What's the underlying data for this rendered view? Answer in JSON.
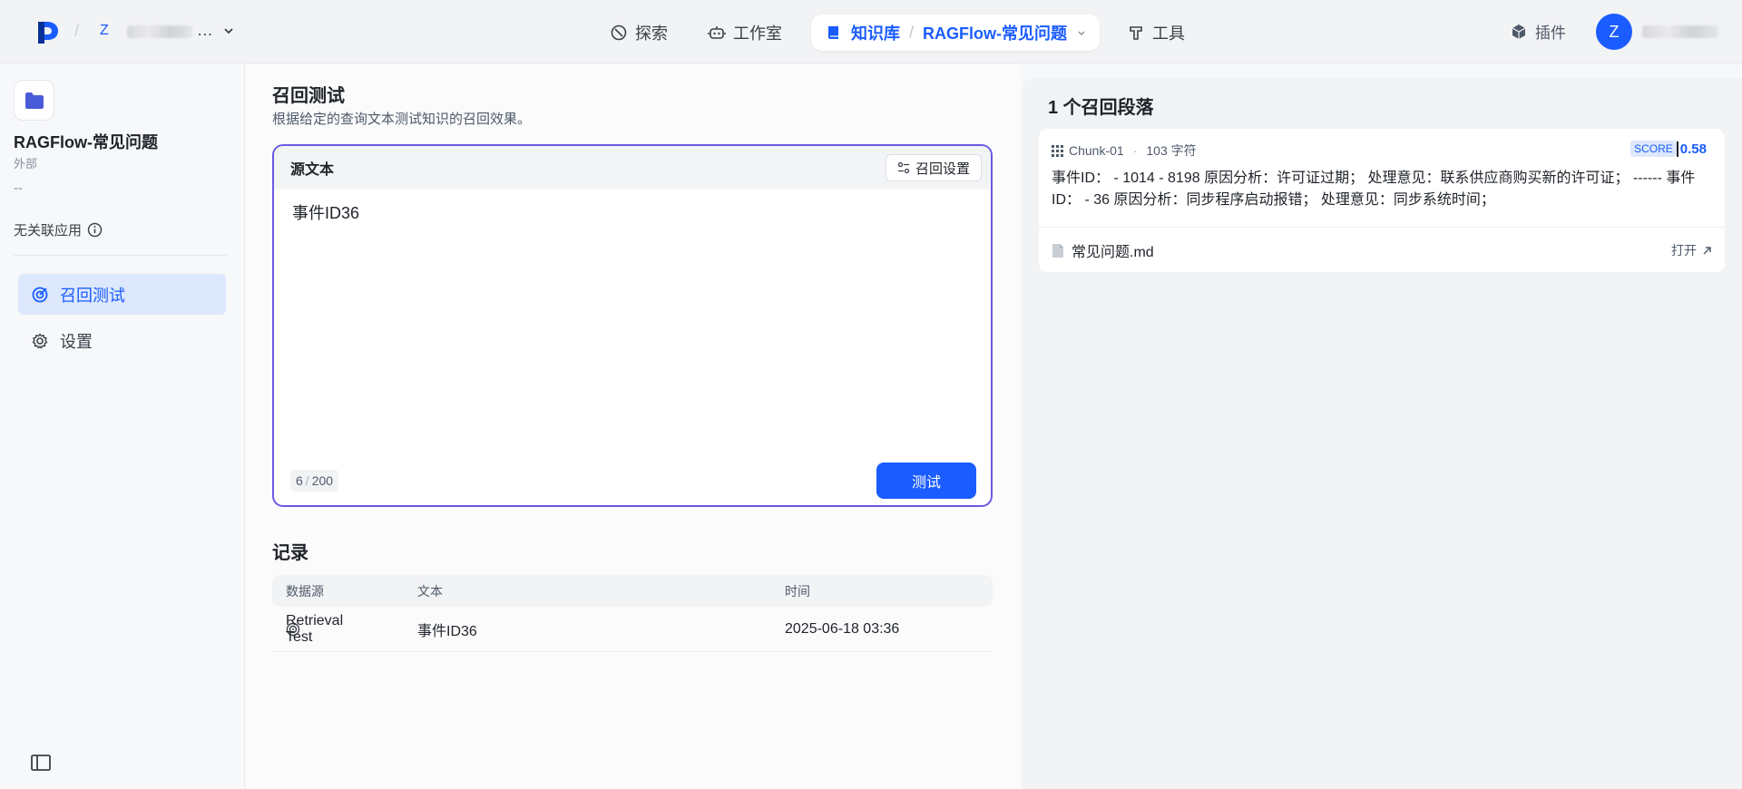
{
  "topbar": {
    "workspace_initial": "Z",
    "workspace_name_suffix": "...",
    "nav": [
      {
        "label": "探索",
        "icon": "explore-icon"
      },
      {
        "label": "工作室",
        "icon": "robot-icon"
      }
    ],
    "kb_nav": {
      "label": "知识库",
      "separator": "/",
      "current": "RAGFlow-常见问题"
    },
    "tools_label": "工具",
    "plugin_label": "插件",
    "avatar_initial": "Z"
  },
  "sidebar": {
    "kb_title": "RAGFlow-常见问题",
    "kb_type": "外部",
    "kb_dash": "--",
    "kb_app": "无关联应用",
    "items": [
      {
        "label": "召回测试",
        "active": true
      },
      {
        "label": "设置",
        "active": false
      }
    ]
  },
  "main": {
    "title": "召回测试",
    "description": "根据给定的查询文本测试知识的召回效果。",
    "source_label": "源文本",
    "recall_settings_label": "召回设置",
    "source_text": "事件ID36",
    "char_count": "6",
    "char_max": "200",
    "test_label": "测试",
    "records_title": "记录",
    "records_columns": [
      "数据源",
      "文本",
      "时间"
    ],
    "records": [
      {
        "source": "Retrieval Test",
        "text": "事件ID36",
        "time": "2025-06-18 03:36"
      }
    ]
  },
  "results": {
    "title": "1 个召回段落",
    "chunks": [
      {
        "id": "Chunk-01",
        "chars": "103 字符",
        "score_label": "SCORE",
        "score": "0.58",
        "text": "事件ID： - 1014 - 8198 原因分析：许可证过期； 处理意见：联系供应商购买新的许可证； ------ 事件ID： - 36 原因分析：同步程序启动报错； 处理意见：同步系统时间；",
        "file": "常见问题.md",
        "open_label": "打开"
      }
    ]
  },
  "colors": {
    "accent": "#1a5cff",
    "border_focus": "#6a5ae0"
  }
}
